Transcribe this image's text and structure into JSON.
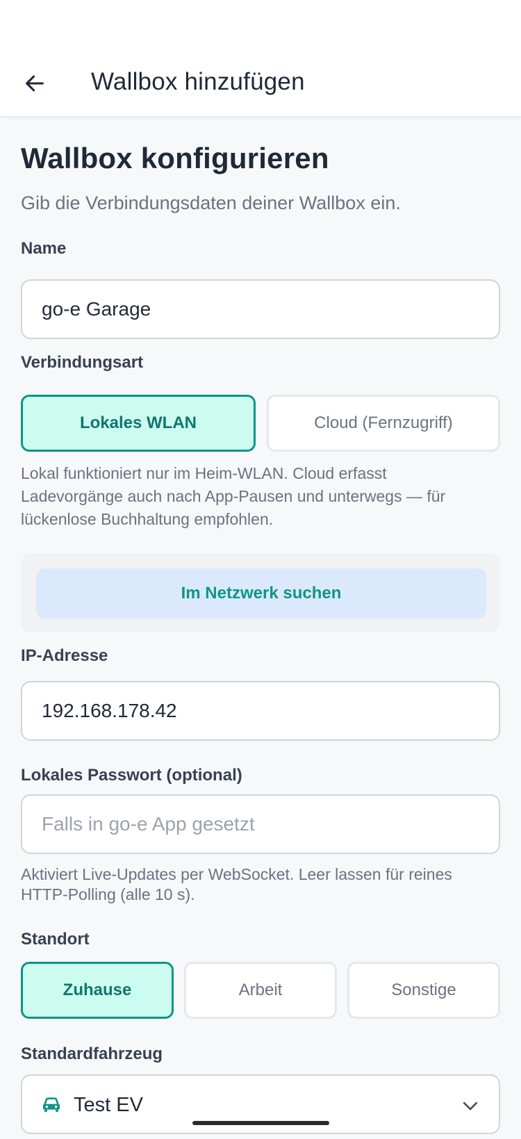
{
  "header": {
    "title": "Wallbox hinzufügen"
  },
  "page": {
    "heading": "Wallbox konfigurieren",
    "subtitle": "Gib die Verbindungsdaten deiner Wallbox ein."
  },
  "name_field": {
    "label": "Name",
    "value": "go-e Garage"
  },
  "connection": {
    "label": "Verbindungsart",
    "options": [
      "Lokales WLAN",
      "Cloud (Fernzugriff)"
    ],
    "selected": "Lokales WLAN",
    "help_lines": [
      "Lokal funktioniert nur im Heim-WLAN. Cloud erfasst",
      "Ladevorgänge auch nach App-Pausen und unterwegs — für",
      "lückenlose Buchhaltung empfohlen."
    ]
  },
  "scan": {
    "label": "Im Netzwerk suchen"
  },
  "ip_field": {
    "label": "IP-Adresse",
    "value": "192.168.178.42"
  },
  "password_field": {
    "label": "Lokales Passwort (optional)",
    "placeholder": "Falls in go-e App gesetzt",
    "help_lines": [
      "Aktiviert Live-Updates per WebSocket. Leer lassen für reines",
      "HTTP-Polling (alle 10 s)."
    ]
  },
  "location": {
    "label": "Standort",
    "options": [
      "Zuhause",
      "Arbeit",
      "Sonstige"
    ],
    "selected": "Zuhause"
  },
  "vehicle": {
    "label": "Standardfahrzeug",
    "value": "Test EV"
  },
  "colors": {
    "accent": "#0d9488",
    "accent_bg": "#ccfbef",
    "scan_bg": "#dbe9fc"
  }
}
